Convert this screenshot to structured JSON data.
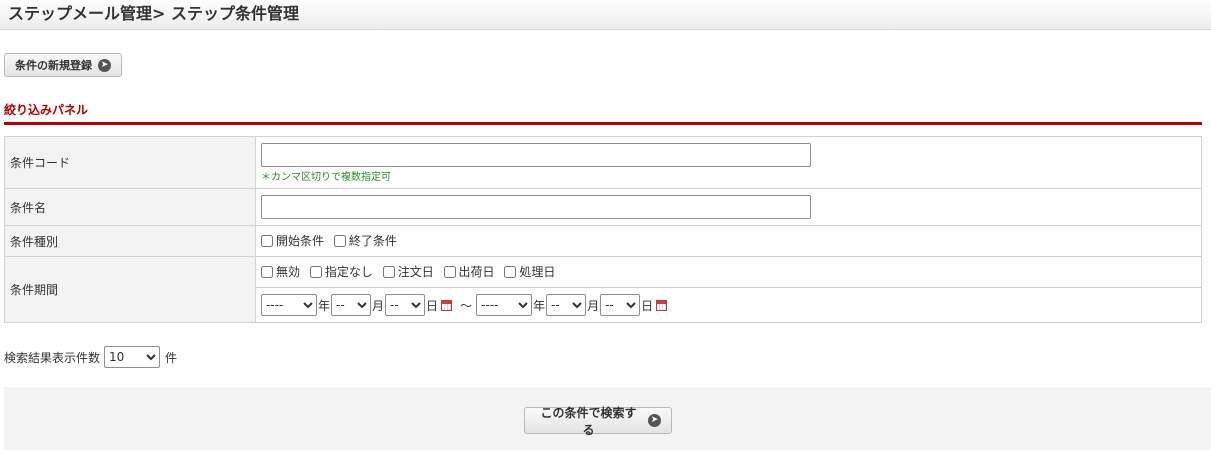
{
  "header": {
    "title": "ステップメール管理> ステップ条件管理"
  },
  "actions": {
    "new_label": "条件の新規登録"
  },
  "panel": {
    "title": "絞り込みパネル"
  },
  "form": {
    "code_label": "条件コード",
    "code_value": "",
    "code_note": "＊カンマ区切りで複数指定可",
    "name_label": "条件名",
    "name_value": "",
    "type_label": "条件種別",
    "type_options": [
      "開始条件",
      "終了条件"
    ],
    "period_label": "条件期間",
    "period_options": [
      "無効",
      "指定なし",
      "注文日",
      "出荷日",
      "処理日"
    ],
    "date": {
      "year_default": "----",
      "md_default": "--",
      "year_unit": "年",
      "month_unit": "月",
      "day_unit": "日",
      "separator": "～"
    }
  },
  "results": {
    "label": "検索結果表示件数",
    "value": "10",
    "unit": "件"
  },
  "search": {
    "button_label": "この条件で検索する"
  },
  "icons": {
    "button_arrow": "circle-arrow-right-icon",
    "calendar": "calendar-icon"
  },
  "colors": {
    "accent": "#b20000",
    "note": "#2a8a2a"
  }
}
